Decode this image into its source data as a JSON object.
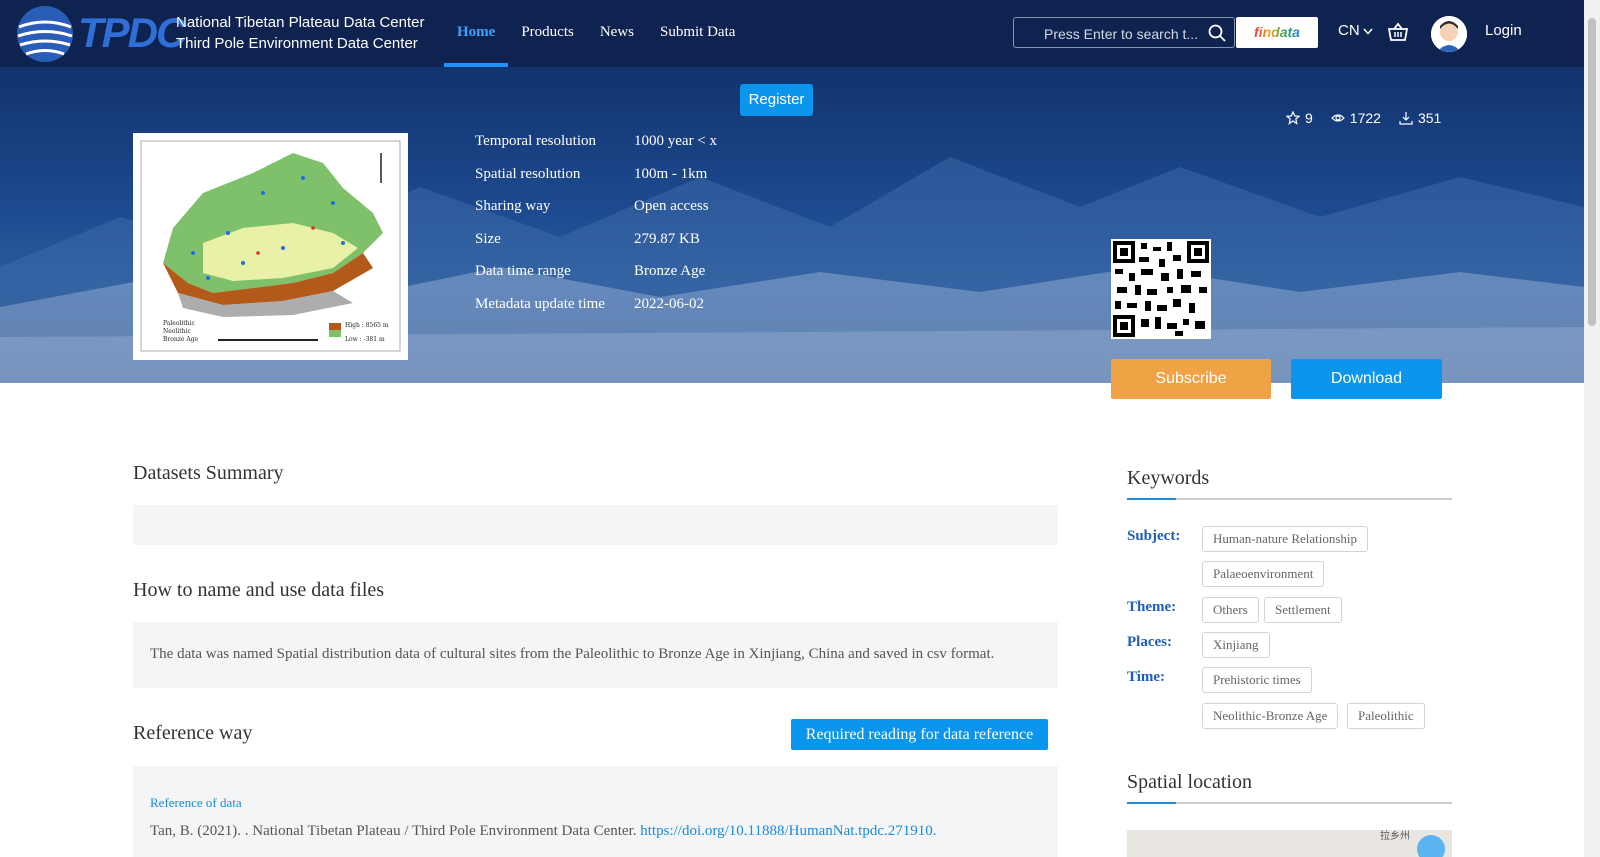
{
  "header": {
    "logo_text": "TPDC",
    "center_name_line1": "National Tibetan Plateau Data Center",
    "center_name_line2": "Third Pole Environment Data Center",
    "nav": [
      {
        "label": "Home",
        "active": true
      },
      {
        "label": "Products",
        "active": false
      },
      {
        "label": "News",
        "active": false
      },
      {
        "label": "Submit Data",
        "active": false
      }
    ],
    "search_placeholder": "Press Enter to search t...",
    "findata_label": "findata",
    "language": "CN",
    "login_label": "Login"
  },
  "hero": {
    "register_label": "Register",
    "stats": {
      "stars": "9",
      "views": "1722",
      "downloads": "351"
    },
    "metadata": [
      {
        "key": "Temporal resolution",
        "value": "1000 year < x"
      },
      {
        "key": "Spatial resolution",
        "value": "100m - 1km"
      },
      {
        "key": "Sharing way",
        "value": "Open access"
      },
      {
        "key": "Size",
        "value": "279.87 KB"
      },
      {
        "key": "Data time range",
        "value": "Bronze Age"
      },
      {
        "key": "Metadata update time",
        "value": "2022-06-02"
      }
    ],
    "thumbnail_legend": [
      "Paleolithic",
      "Neolithic",
      "Bronze Age"
    ],
    "thumbnail_high": "High : 8565 m",
    "thumbnail_low": "Low : -381 m",
    "subscribe_label": "Subscribe",
    "download_label": "Download"
  },
  "main": {
    "summary_title": "Datasets Summary",
    "summary_text": "",
    "naming_title": "How to name and use data files",
    "naming_text": "The data was named Spatial distribution data of cultural sites from the Paleolithic to Bronze Age in Xinjiang, China and saved in csv format.",
    "reference_title": "Reference way",
    "reference_button": "Required reading for data reference",
    "reference_label": "Reference of data",
    "reference_text": "Tan, B. (2021). . National Tibetan Plateau / Third Pole Environment Data Center.",
    "reference_link": "https://doi.org/10.11888/HumanNat.tpdc.271910."
  },
  "sidebar": {
    "keywords_title": "Keywords",
    "keyword_groups": [
      {
        "label": "Subject:",
        "tags": [
          "Human-nature Relationship",
          "Palaeoenvironment"
        ]
      },
      {
        "label": "Theme:",
        "tags": [
          "Others",
          "Settlement"
        ]
      },
      {
        "label": "Places:",
        "tags": [
          "Xinjiang"
        ]
      },
      {
        "label": "Time:",
        "tags": [
          "Prehistoric times",
          "Neolithic-Bronze Age",
          "Paleolithic"
        ]
      }
    ],
    "spatial_title": "Spatial location",
    "map_text": "拉乡州"
  },
  "colors": {
    "nav_bg": "#0f2350",
    "accent_blue": "#0b95ec",
    "subscribe_orange": "#f0a345",
    "keyword_label": "#1d5fb9"
  }
}
